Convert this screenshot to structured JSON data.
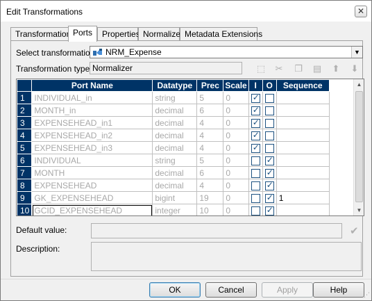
{
  "window": {
    "title": "Edit Transformations",
    "close_glyph": "✕"
  },
  "tabs": [
    {
      "label": "Transformation"
    },
    {
      "label": "Ports"
    },
    {
      "label": "Properties"
    },
    {
      "label": "Normalizer"
    },
    {
      "label": "Metadata Extensions"
    }
  ],
  "select_transformation": {
    "label": "Select transformation:",
    "value": "NRM_Expense"
  },
  "transformation_type": {
    "label": "Transformation type:",
    "value": "Normalizer"
  },
  "toolbar": {
    "icons": [
      "new-port-icon",
      "cut-icon",
      "copy-icon",
      "paste-icon",
      "move-up-icon",
      "move-down-icon"
    ]
  },
  "grid": {
    "columns": [
      "Port Name",
      "Datatype",
      "Prec",
      "Scale",
      "I",
      "O",
      "Sequence"
    ],
    "rows": [
      {
        "num": "1",
        "name": "INDIVIDUAL_in",
        "datatype": "string",
        "prec": "5",
        "scale": "0",
        "i": true,
        "o": false,
        "seq": ""
      },
      {
        "num": "2",
        "name": "MONTH_in",
        "datatype": "decimal",
        "prec": "6",
        "scale": "0",
        "i": true,
        "o": false,
        "seq": ""
      },
      {
        "num": "3",
        "name": "EXPENSEHEAD_in1",
        "datatype": "decimal",
        "prec": "4",
        "scale": "0",
        "i": true,
        "o": false,
        "seq": ""
      },
      {
        "num": "4",
        "name": "EXPENSEHEAD_in2",
        "datatype": "decimal",
        "prec": "4",
        "scale": "0",
        "i": true,
        "o": false,
        "seq": ""
      },
      {
        "num": "5",
        "name": "EXPENSEHEAD_in3",
        "datatype": "decimal",
        "prec": "4",
        "scale": "0",
        "i": true,
        "o": false,
        "seq": ""
      },
      {
        "num": "6",
        "name": "INDIVIDUAL",
        "datatype": "string",
        "prec": "5",
        "scale": "0",
        "i": false,
        "o": true,
        "seq": ""
      },
      {
        "num": "7",
        "name": "MONTH",
        "datatype": "decimal",
        "prec": "6",
        "scale": "0",
        "i": false,
        "o": true,
        "seq": ""
      },
      {
        "num": "8",
        "name": "EXPENSEHEAD",
        "datatype": "decimal",
        "prec": "4",
        "scale": "0",
        "i": false,
        "o": true,
        "seq": ""
      },
      {
        "num": "9",
        "name": "GK_EXPENSEHEAD",
        "datatype": "bigint",
        "prec": "19",
        "scale": "0",
        "i": false,
        "o": true,
        "seq": "1"
      },
      {
        "num": "10",
        "name": "GCID_EXPENSEHEAD",
        "datatype": "integer",
        "prec": "10",
        "scale": "0",
        "i": false,
        "o": true,
        "seq": ""
      }
    ]
  },
  "default_value": {
    "label": "Default value:",
    "value": ""
  },
  "description": {
    "label": "Description:",
    "value": ""
  },
  "buttons": {
    "ok": "OK",
    "cancel": "Cancel",
    "apply": "Apply",
    "help": "Help"
  }
}
